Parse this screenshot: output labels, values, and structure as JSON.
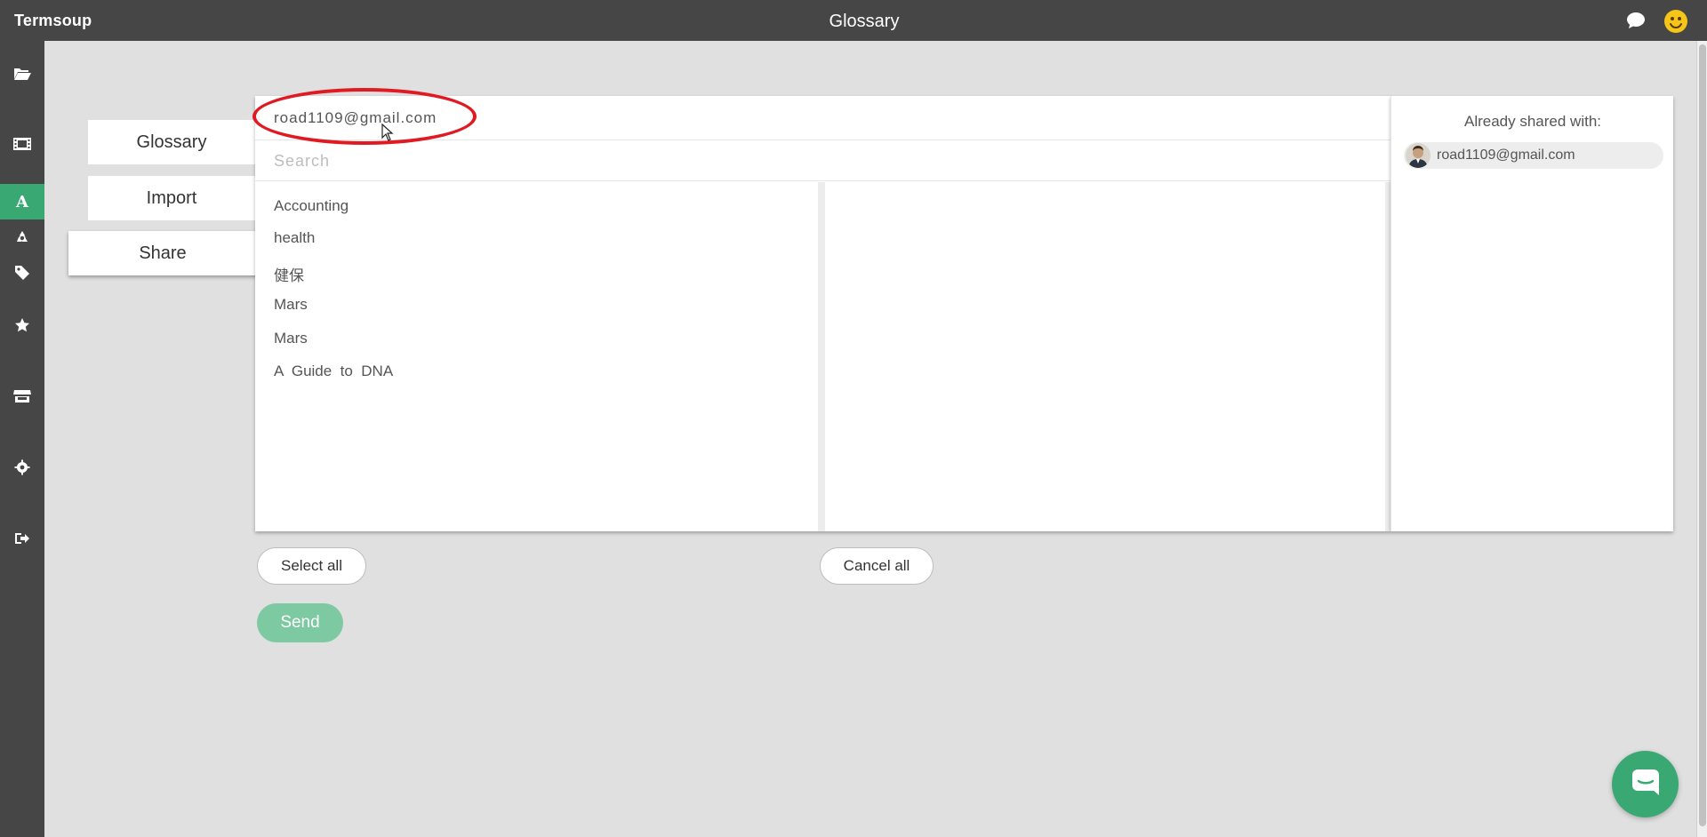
{
  "app": {
    "brand": "Termsoup",
    "page_title": "Glossary"
  },
  "sidebar": {
    "items": [
      {
        "icon": "folder-open-icon"
      },
      {
        "icon": "film-icon"
      },
      {
        "icon": "letter-a-icon",
        "label": "A",
        "active": true
      },
      {
        "icon": "recycle-icon"
      },
      {
        "icon": "tag-icon"
      },
      {
        "icon": "star-icon"
      },
      {
        "icon": "store-icon"
      },
      {
        "icon": "gear-icon"
      },
      {
        "icon": "sign-out-icon"
      }
    ]
  },
  "tabs": {
    "glossary": "Glossary",
    "import": "Import",
    "share": "Share"
  },
  "share_form": {
    "email_value": "road1109@gmail.com",
    "search_placeholder": "Search",
    "glossaries": [
      "Accounting",
      "health",
      "健保",
      "Mars",
      "Mars",
      "A  Guide  to  DNA"
    ]
  },
  "shared_with": {
    "title": "Already shared with:",
    "users": [
      {
        "email": "road1109@gmail.com"
      }
    ]
  },
  "buttons": {
    "select_all": "Select all",
    "cancel_all": "Cancel all",
    "send": "Send"
  },
  "colors": {
    "topbar": "#474647",
    "accent_green": "#3aa873",
    "send_disabled": "#7dc9a2",
    "highlight_red": "#e01a22",
    "background": "#e0e0e0"
  }
}
